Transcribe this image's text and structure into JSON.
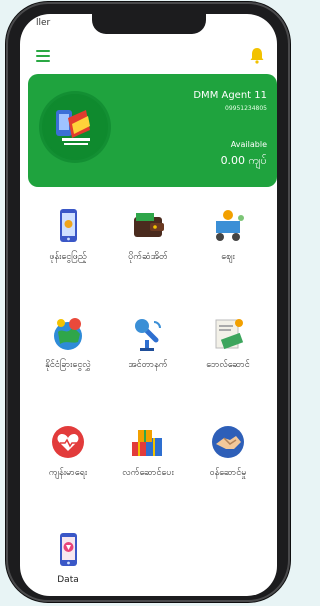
{
  "status": {
    "carrier": "ller"
  },
  "colors": {
    "brand_green": "#1fa33e",
    "accent_yellow": "#f2c200",
    "bg": "#ffffff"
  },
  "header": {
    "menu_icon": "hamburger-icon",
    "bell_icon": "bell-icon"
  },
  "account": {
    "name": "DMM Agent 11",
    "phone": "09951234805",
    "available_label": "Available",
    "balance": "0.00 ကျပ်"
  },
  "services": [
    {
      "label": "ဖုန်းငွေဖြည့်",
      "icon": "phone-topup-icon"
    },
    {
      "label": "ပိုက်ဆံအိတ်",
      "icon": "wallet-icon"
    },
    {
      "label": "ဈေး",
      "icon": "market-icon"
    },
    {
      "label": "နိုင်ငံခြားငွေလွှဲ",
      "icon": "globe-transfer-icon"
    },
    {
      "label": "အင်တာနက်",
      "icon": "internet-antenna-icon"
    },
    {
      "label": "ဘေလ်ဆောင်",
      "icon": "bill-payment-icon"
    },
    {
      "label": "ကျန်းမာရေး",
      "icon": "health-heart-icon"
    },
    {
      "label": "လက်ဆောင်ပေး",
      "icon": "gift-icon"
    },
    {
      "label": "ဝန်ဆောင်မှု",
      "icon": "handshake-service-icon"
    },
    {
      "label": "Data",
      "icon": "data-pack-icon"
    }
  ]
}
